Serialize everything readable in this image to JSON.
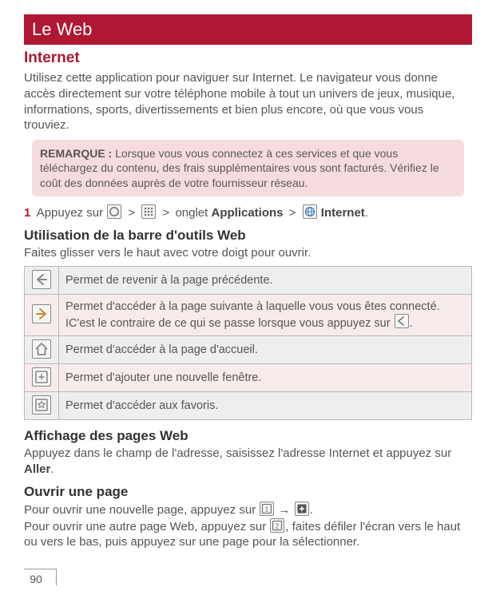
{
  "title": "Le Web",
  "section_internet": "Internet",
  "intro": "Utilisez cette application pour naviguer sur Internet. Le navigateur vous donne accès directement sur votre téléphone mobile à tout un univers de jeux, musique, informations, sports, divertissements et bien plus encore, où que vous vous trouviez.",
  "remark": {
    "label": "REMARQUE :",
    "text": " Lorsque vous vous connectez à ces services et que vous téléchargez du contenu, des frais supplémentaires vous sont facturés. Vérifiez le coût des données auprès de votre fournisseur réseau."
  },
  "step1": {
    "num": "1",
    "pre": " Appuyez sur ",
    "gt": ">",
    "mid1": " ",
    "mid2": " ",
    "tab_prefix": " onglet ",
    "apps_label": "Applications",
    "internet_label": " Internet",
    "period": "."
  },
  "toolbar_heading": "Utilisation de la barre d'outils Web",
  "toolbar_sub": "Faites glisser vers le haut avec votre doigt pour ouvrir.",
  "toolbar": [
    {
      "desc": "Permet de revenir à la page précédente."
    },
    {
      "desc_a": "Permet d'accéder à la page suivante à laquelle vous vous êtes connecté. IC'est le contraire de ce qui se passe lorsque vous appuyez sur ",
      "desc_b": "."
    },
    {
      "desc": "Permet d'accéder à la page d'accueil."
    },
    {
      "desc": "Permet d'ajouter une nouvelle fenêtre."
    },
    {
      "desc": "Permet d'accéder aux favoris."
    }
  ],
  "view_heading": "Affichage des pages Web",
  "view_text_a": "Appuyez dans le champ de l'adresse, saisissez l'adresse Internet et appuyez sur ",
  "view_text_go": "Aller",
  "view_text_b": ".",
  "open_heading": "Ouvrir une page",
  "open_text1_a": "Pour ouvrir une nouvelle page, appuyez sur ",
  "open_arrow": "→",
  "open_text1_b": ".",
  "open_text2_a": "Pour ouvrir une autre page Web, appuyez sur ",
  "open_text2_b": ", faites défiler l'écran vers le haut ou vers le bas, puis appuyez sur une page pour la sélectionner.",
  "page_number": "90",
  "chart_data": null
}
